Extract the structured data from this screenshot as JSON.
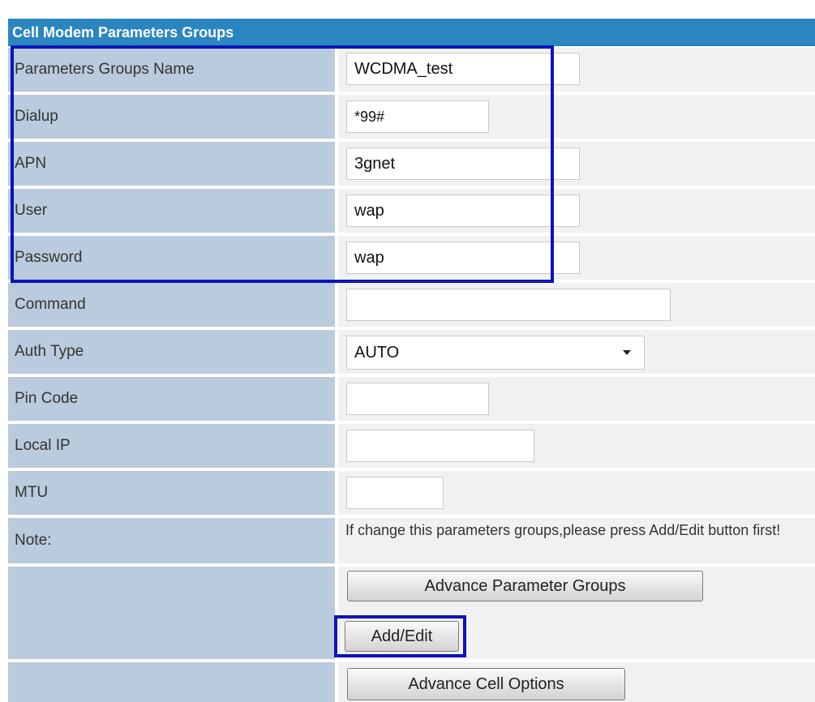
{
  "section": {
    "title": "Cell Modem Parameters Groups"
  },
  "fields": {
    "group_name": {
      "label": "Parameters Groups Name",
      "value": "WCDMA_test"
    },
    "dialup": {
      "label": "Dialup",
      "value": "*99#"
    },
    "apn": {
      "label": "APN",
      "value": "3gnet"
    },
    "user": {
      "label": "User",
      "value": "wap"
    },
    "password": {
      "label": "Password",
      "value": "wap"
    },
    "command": {
      "label": "Command",
      "value": ""
    },
    "auth_type": {
      "label": "Auth Type",
      "value": "AUTO"
    },
    "pin_code": {
      "label": "Pin Code",
      "value": ""
    },
    "local_ip": {
      "label": "Local IP",
      "value": ""
    },
    "mtu": {
      "label": "MTU",
      "value": ""
    }
  },
  "note": {
    "label": "Note:",
    "text": "If change this parameters groups,please press Add/Edit button first!"
  },
  "buttons": {
    "advance_parameter_groups": "Advance Parameter Groups",
    "add_edit": "Add/Edit",
    "advance_cell_options": "Advance Cell Options"
  },
  "colors": {
    "header_bg": "#2b86c0",
    "label_bg": "#b9cbdd",
    "value_bg": "#f1f1f1",
    "highlight": "#0b14b8"
  }
}
